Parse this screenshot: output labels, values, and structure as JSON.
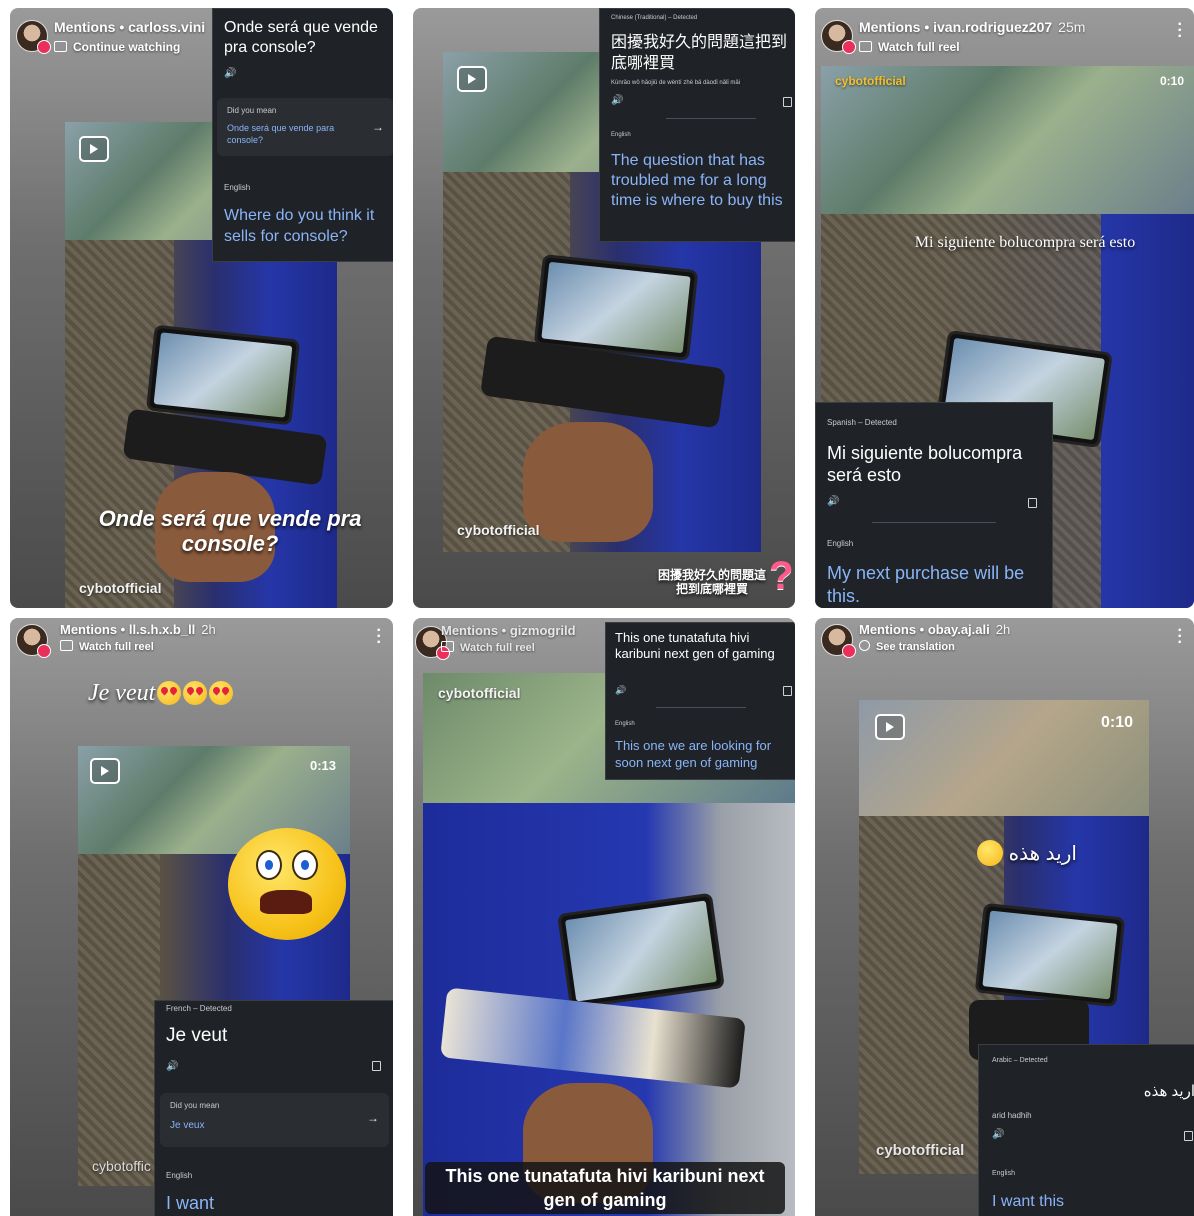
{
  "stories": [
    {
      "user": "Mentions • carloss.vini",
      "time": "",
      "subtitle": "Continue watching",
      "watermark": "cybotofficial",
      "caption": "Onde será que vende pra console?",
      "translation": {
        "source": "Onde será que vende pra console?",
        "dym_label": "Did you mean",
        "dym_value": "Onde será que vende para console?",
        "target_lang": "English",
        "target": "Where do you think it sells for console?"
      }
    },
    {
      "watermark": "cybotofficial",
      "overlay_text": "困擾我好久的問題這把到底哪裡買",
      "translation": {
        "source_lang": "Chinese (Traditional) – Detected",
        "source": "困擾我好久的問題這把到底哪裡買",
        "romanization": "Kùnrǎo wǒ hǎojiǔ de wèntí zhè bǎ dàodǐ nǎlǐ mǎi",
        "target_lang": "English",
        "target": "The question that has troubled me for a long time is where to buy this"
      }
    },
    {
      "user": "Mentions • ivan.rodriguez207",
      "time": "25m",
      "subtitle": "Watch full reel",
      "watermark": "cybotofficial",
      "timer": "0:10",
      "caption": "Mi siguiente bolucompra será esto",
      "translation": {
        "source_lang": "Spanish – Detected",
        "source": "Mi siguiente bolucompra será esto",
        "target_lang": "English",
        "target": "My next purchase will be this."
      }
    },
    {
      "user": "Mentions • ll.s.h.x.b_ll",
      "time": "2h",
      "subtitle": "Watch full reel",
      "watermark": "cybotoffic",
      "timer": "0:13",
      "caption": "Je veut",
      "translation": {
        "source_lang": "French – Detected",
        "source": "Je veut",
        "dym_label": "Did you mean",
        "dym_value": "Je veux",
        "target_lang": "English",
        "target": "I want"
      }
    },
    {
      "user": "Mentions • gizmogrild",
      "time": "",
      "subtitle": "Watch full reel",
      "watermark": "cybotofficial",
      "caption": "This one tunatafuta hivi karibuni next gen of gaming",
      "translation": {
        "source": "This one tunatafuta hivi karibuni next gen of gaming",
        "target_lang": "English",
        "target": "This one we are looking for soon next gen of gaming"
      }
    },
    {
      "user": "Mentions • obay.aj.ali",
      "time": "2h",
      "subtitle": "See translation",
      "watermark": "cybotofficial",
      "timer": "0:10",
      "caption": "اريد هذه",
      "translation": {
        "source_lang": "Arabic – Detected",
        "source": "اريد هذه",
        "romanization": "arid hadhih",
        "target_lang": "English",
        "target": "I want this"
      }
    }
  ],
  "colors": {
    "panel_bg": "#1f2226",
    "target_text": "#8ab4f8",
    "phone_frame_blue": "#2536a8"
  }
}
